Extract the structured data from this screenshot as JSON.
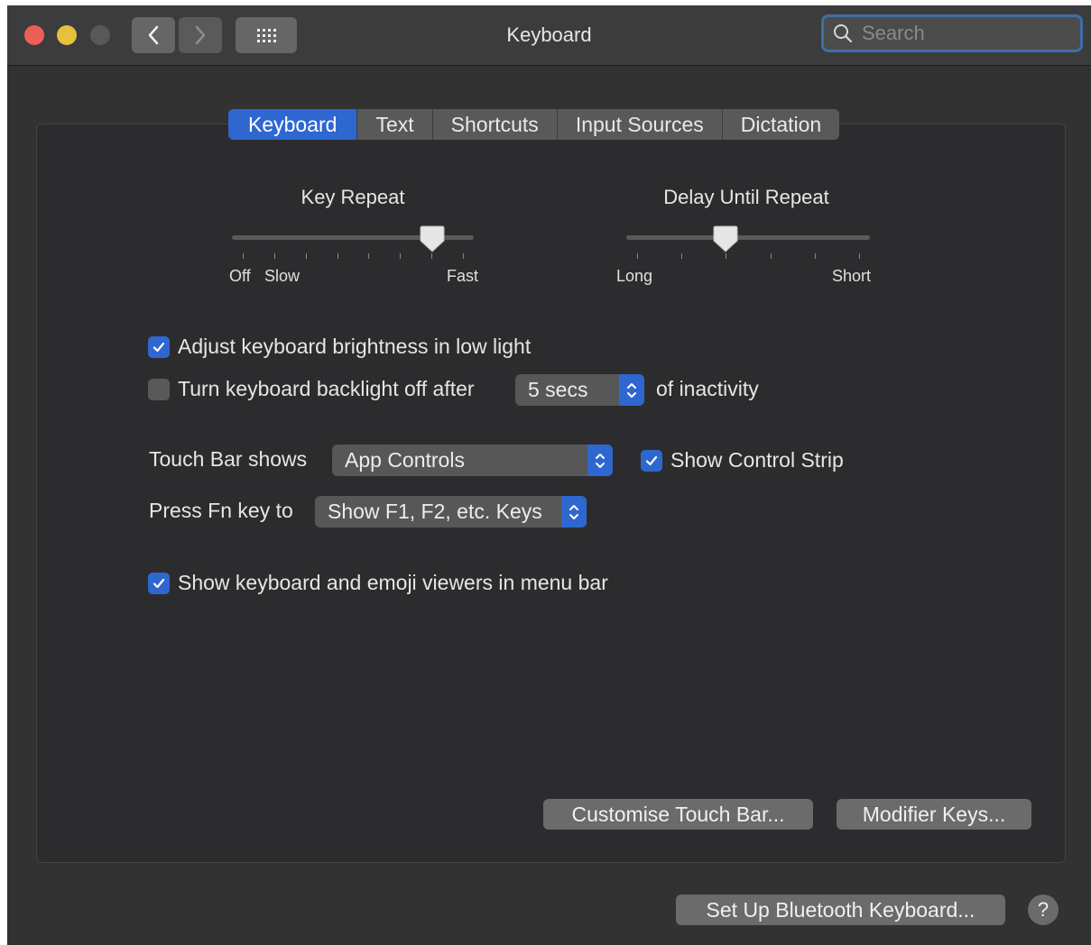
{
  "window": {
    "title": "Keyboard"
  },
  "search": {
    "placeholder": "Search"
  },
  "tabs": [
    {
      "label": "Keyboard",
      "active": true
    },
    {
      "label": "Text",
      "active": false
    },
    {
      "label": "Shortcuts",
      "active": false
    },
    {
      "label": "Input Sources",
      "active": false
    },
    {
      "label": "Dictation",
      "active": false
    }
  ],
  "key_repeat": {
    "title": "Key Repeat",
    "labels": [
      "Off",
      "Slow",
      "Fast"
    ],
    "level": 0.86,
    "ticks": 8
  },
  "delay_until_repeat": {
    "title": "Delay Until Repeat",
    "labels": [
      "Long",
      "Short"
    ],
    "level": 0.4,
    "ticks": 6
  },
  "options": {
    "adjust_brightness": {
      "label": "Adjust keyboard brightness in low light",
      "checked": true
    },
    "backlight_off": {
      "label": "Turn keyboard backlight off after",
      "checked": false,
      "value": "5 secs",
      "suffix": "of inactivity"
    },
    "touch_bar": {
      "label": "Touch Bar shows",
      "value": "App Controls"
    },
    "control_strip": {
      "label": "Show Control Strip",
      "checked": true
    },
    "fn_key": {
      "label": "Press Fn key to",
      "value": "Show F1, F2, etc. Keys"
    },
    "emoji_viewers": {
      "label": "Show keyboard and emoji viewers in menu bar",
      "checked": true
    }
  },
  "buttons": {
    "customise_touch_bar": "Customise Touch Bar...",
    "modifier_keys": "Modifier Keys...",
    "bluetooth_keyboard": "Set Up Bluetooth Keyboard...",
    "help": "?"
  },
  "colors": {
    "accent": "#2f67d0",
    "window_bg": "#323232",
    "close": "#ec5f56",
    "minimize": "#e6c13d"
  }
}
